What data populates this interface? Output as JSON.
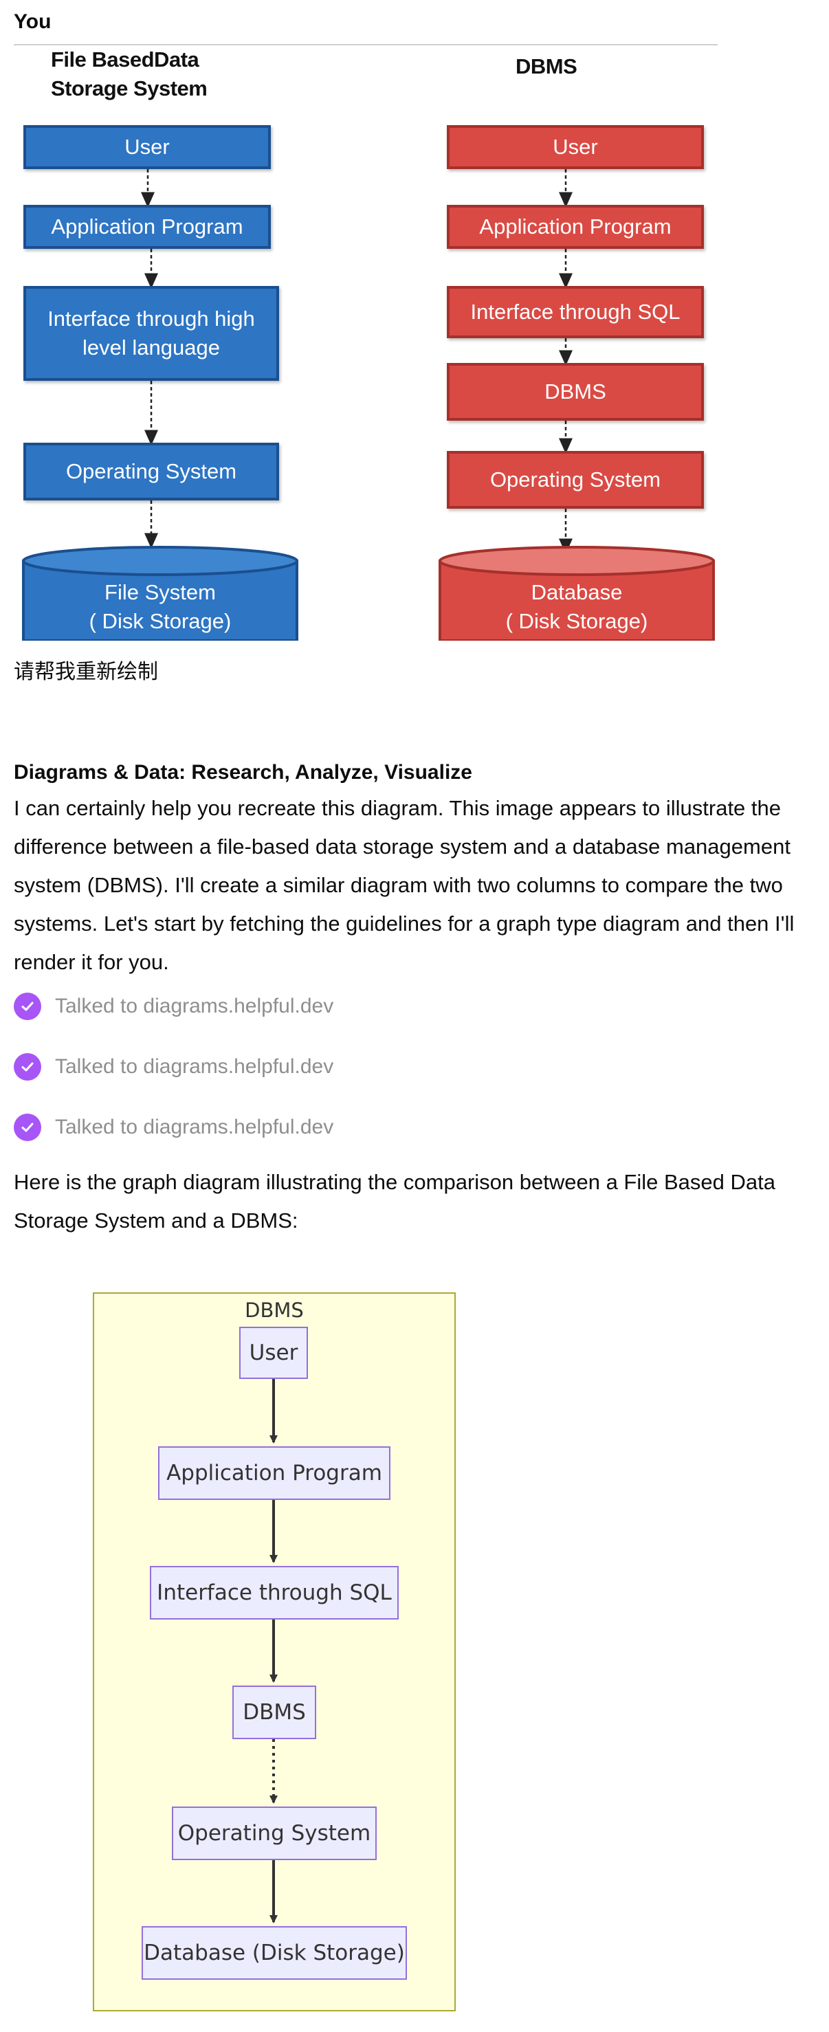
{
  "user_turn": {
    "speaker": "You",
    "message": "请帮我重新绘制"
  },
  "uploaded_image": {
    "left_column": {
      "title_line1": "File BasedData",
      "title_line2": "Storage System",
      "boxes": [
        "User",
        "Application Program",
        "Interface through high",
        "level language",
        "Operating System"
      ],
      "storage_line1": "File System",
      "storage_line2": "( Disk Storage)",
      "color": "#2e75c3"
    },
    "right_column": {
      "title": "DBMS",
      "boxes": [
        "User",
        "Application Program",
        "Interface through SQL",
        "DBMS",
        "Operating System"
      ],
      "storage_line1": "Database",
      "storage_line2": "( Disk Storage)",
      "color": "#da4a44"
    }
  },
  "assistant_turn": {
    "speaker": "Diagrams & Data: Research, Analyze, Visualize",
    "intro_lines": [
      "I can certainly help you recreate this diagram. This image appears to illustrate the",
      "difference between a file-based data storage system and a database management",
      "system (DBMS). I'll create a similar diagram with two columns to compare the two",
      "systems. Let's start by fetching the guidelines for a graph type diagram and then I'll",
      "render it for you."
    ],
    "tool_calls": [
      "Talked to diagrams.helpful.dev",
      "Talked to diagrams.helpful.dev",
      "Talked to diagrams.helpful.dev"
    ],
    "result_lines": [
      "Here is the graph diagram illustrating the comparison between a File Based Data",
      "Storage System and a DBMS:"
    ],
    "accent_color": "#a855f7"
  },
  "rendered_diagram": {
    "cluster_title": "DBMS",
    "nodes": [
      "User",
      "Application Program",
      "Interface through SQL",
      "DBMS",
      "Operating System",
      "Database (Disk Storage)"
    ],
    "edges": [
      {
        "from": "User",
        "to": "Application Program",
        "style": "solid"
      },
      {
        "from": "Application Program",
        "to": "Interface through SQL",
        "style": "solid"
      },
      {
        "from": "Interface through SQL",
        "to": "DBMS",
        "style": "solid"
      },
      {
        "from": "DBMS",
        "to": "Operating System",
        "style": "dotted"
      },
      {
        "from": "Operating System",
        "to": "Database (Disk Storage)",
        "style": "solid"
      }
    ]
  }
}
